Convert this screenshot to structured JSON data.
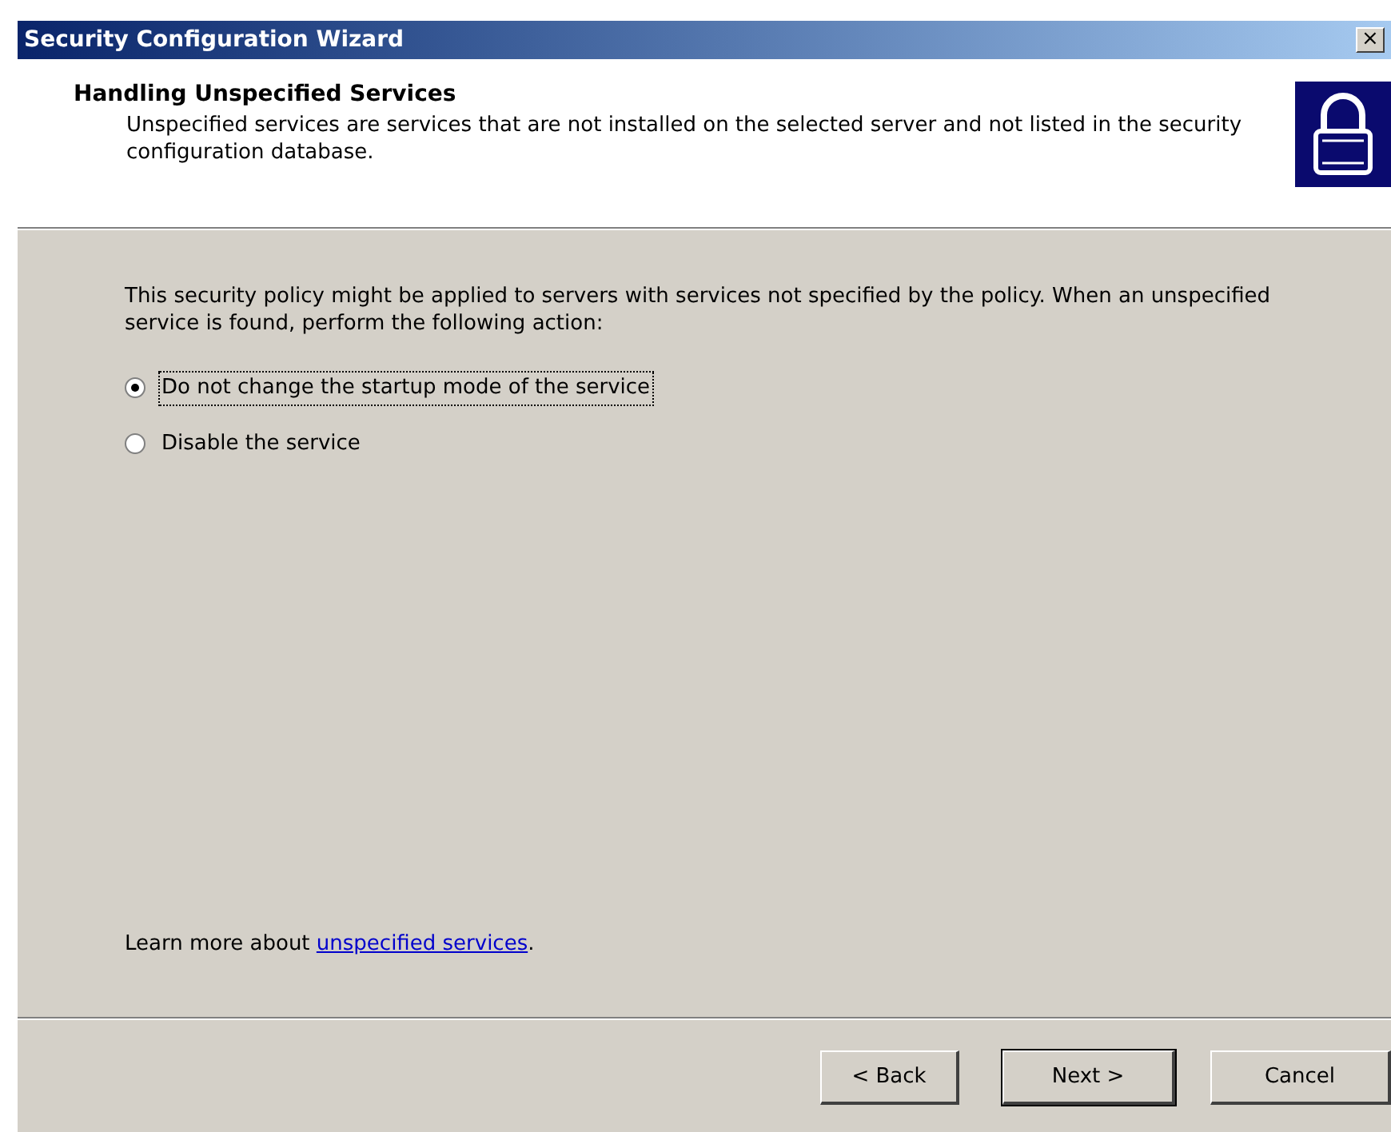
{
  "window": {
    "title": "Security Configuration Wizard",
    "close": "×"
  },
  "header": {
    "title": "Handling Unspecified Services",
    "description": "Unspecified services are services that are not installed on the selected server and not listed in the security configuration database."
  },
  "body": {
    "intro": "This security policy might be applied to servers with services not specified by the policy. When an unspecified service is found, perform the following action:",
    "options": [
      {
        "label": "Do not change the startup mode of the service",
        "selected": true,
        "focused": true
      },
      {
        "label": "Disable the service",
        "selected": false,
        "focused": false
      }
    ],
    "learn_more": {
      "text": "Learn more about ",
      "link": "unspecified services",
      "suffix": "."
    }
  },
  "buttons": [
    {
      "label": "< Back",
      "default": false
    },
    {
      "label": "Next >",
      "default": true
    },
    {
      "label": "Cancel",
      "default": false
    }
  ]
}
